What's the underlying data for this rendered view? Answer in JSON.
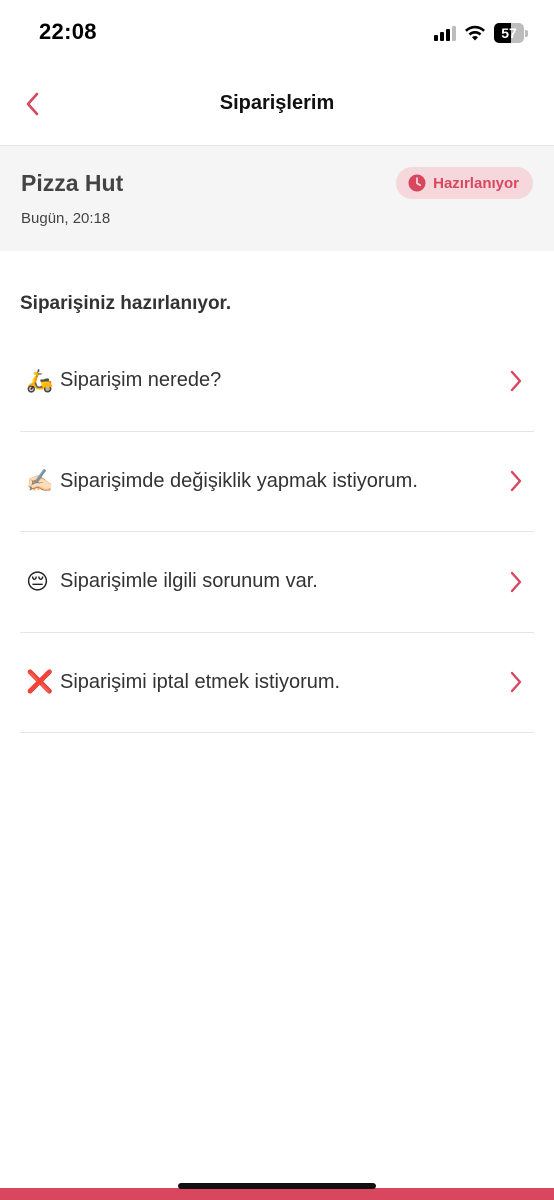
{
  "status_bar": {
    "time": "22:08",
    "battery": "57"
  },
  "nav": {
    "title": "Siparişlerim"
  },
  "order": {
    "restaurant": "Pizza Hut",
    "time": "Bugün, 20:18",
    "status": "Hazırlanıyor"
  },
  "section": {
    "heading": "Siparişiniz hazırlanıyor."
  },
  "help_items": [
    {
      "emoji": "🛵",
      "label": "Siparişim nerede?"
    },
    {
      "emoji": "✍🏻",
      "label": "Siparişimde değişiklik yapmak istiyorum."
    },
    {
      "emoji": "😔",
      "label": "Siparişimle ilgili sorunum var."
    },
    {
      "emoji": "❌",
      "label": "Siparişimi iptal etmek istiyorum."
    }
  ],
  "colors": {
    "accent": "#d9475f",
    "badge_bg": "#f6d7dc",
    "card_bg": "#f5f5f5"
  }
}
